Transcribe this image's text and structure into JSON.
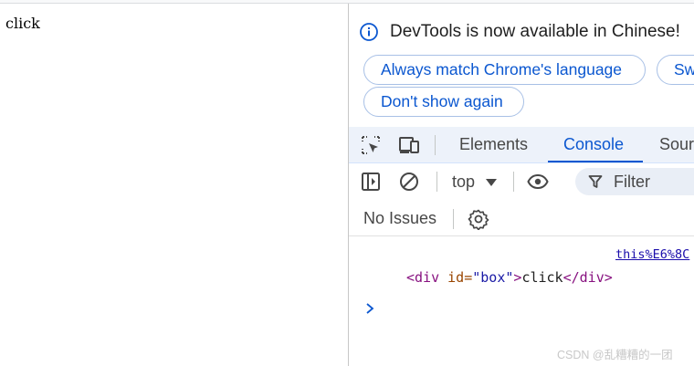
{
  "page": {
    "text": "click"
  },
  "devtools": {
    "infobar": {
      "title": "DevTools is now available in Chinese!",
      "match_button": "Always match Chrome's language",
      "switch_button": "Sw",
      "dont_show_button": "Don't show again"
    },
    "tabs": [
      {
        "label": "Elements"
      },
      {
        "label": "Console"
      },
      {
        "label": "Sour"
      }
    ],
    "active_tab": "Console",
    "console_toolbar": {
      "context": "top",
      "filter_placeholder": "Filter"
    },
    "issues": {
      "label": "No Issues"
    },
    "console": {
      "source_link": "this%E6%8C",
      "code": {
        "open_tag_start": "<div",
        "attr_name": " id=",
        "attr_value": "\"box\"",
        "open_tag_end": ">",
        "text": "click",
        "close_tag": "</div>"
      }
    },
    "accent_color": "#0b57d0"
  },
  "watermark": "CSDN @乱糟糟的一团"
}
